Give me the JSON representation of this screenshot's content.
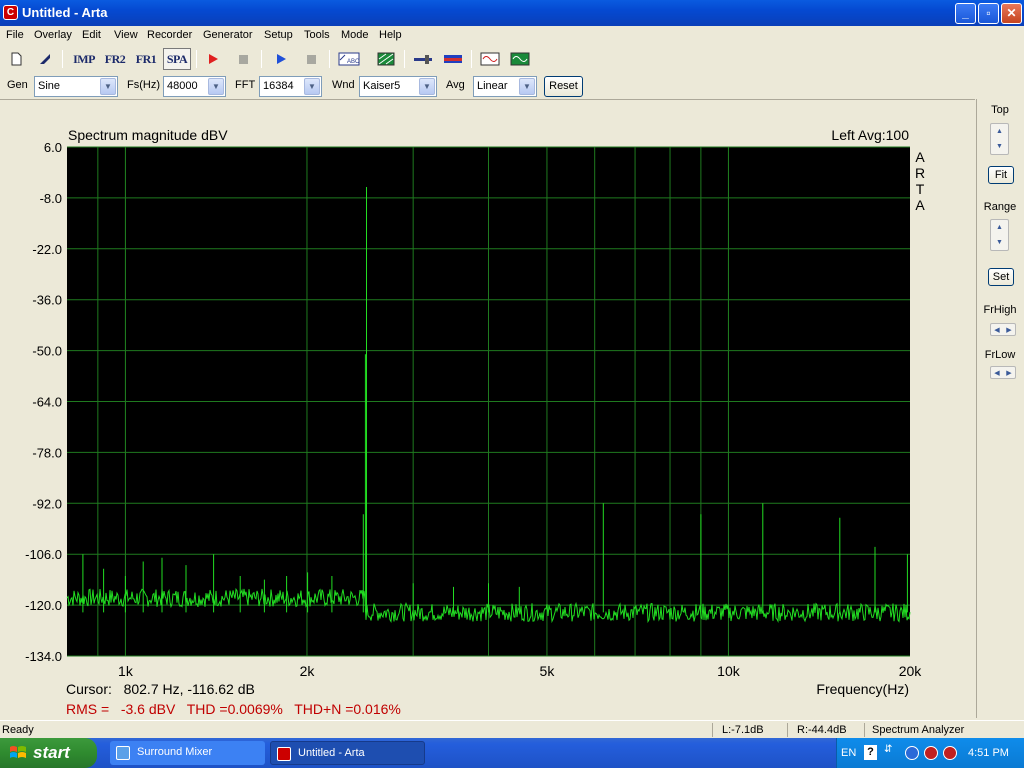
{
  "window": {
    "title": "Untitled - Arta",
    "app_icon": "arta-app-icon",
    "minimize": "_",
    "maximize": "▫",
    "close": "✕"
  },
  "menu": [
    "File",
    "Overlay",
    "Edit",
    "View",
    "Recorder",
    "Generator",
    "Setup",
    "Tools",
    "Mode",
    "Help"
  ],
  "toolbar": {
    "imp": "IMP",
    "fr2": "FR2",
    "fr1": "FR1",
    "spa": "SPA"
  },
  "controls": {
    "gen_label": "Gen",
    "gen_value": "Sine",
    "fs_label": "Fs(Hz)",
    "fs_value": "48000",
    "fft_label": "FFT",
    "fft_value": "16384",
    "wnd_label": "Wnd",
    "wnd_value": "Kaiser5",
    "avg_label": "Avg",
    "avg_value": "Linear",
    "reset": "Reset"
  },
  "right_panel": {
    "top": "Top",
    "fit": "Fit",
    "range": "Range",
    "set": "Set",
    "frhigh": "FrHigh",
    "frlow": "FrLow"
  },
  "chart_data": {
    "type": "line",
    "title": "Spectrum magnitude dBV",
    "info": "Left  Avg:100",
    "watermark": "ARTA",
    "xlabel": "Frequency(Hz)",
    "x_scale": "log",
    "xlim": [
      800,
      20000
    ],
    "x_ticks": [
      {
        "v": 1000,
        "label": "1k"
      },
      {
        "v": 2000,
        "label": "2k"
      },
      {
        "v": 5000,
        "label": "5k"
      },
      {
        "v": 10000,
        "label": "10k"
      },
      {
        "v": 20000,
        "label": "20k"
      }
    ],
    "ylim": [
      -134,
      6
    ],
    "y_ticks": [
      "6.0",
      "-8.0",
      "-22.0",
      "-36.0",
      "-50.0",
      "-64.0",
      "-78.0",
      "-92.0",
      "-106.0",
      "-120.0",
      "-134.0"
    ],
    "grid": true,
    "background": "#000000",
    "line_color": "#22dd22",
    "noise_floor_dbv": -120,
    "peaks": [
      {
        "f": 850,
        "db": -106
      },
      {
        "f": 920,
        "db": -110
      },
      {
        "f": 1000,
        "db": -112
      },
      {
        "f": 1070,
        "db": -108
      },
      {
        "f": 1150,
        "db": -107
      },
      {
        "f": 1260,
        "db": -109
      },
      {
        "f": 1400,
        "db": -106
      },
      {
        "f": 1550,
        "db": -112
      },
      {
        "f": 1700,
        "db": -113
      },
      {
        "f": 1850,
        "db": -112
      },
      {
        "f": 2005,
        "db": -111
      },
      {
        "f": 2200,
        "db": -112
      },
      {
        "f": 2480,
        "db": -95
      },
      {
        "f": 2500,
        "db": -51
      },
      {
        "f": 2510,
        "db": -5
      },
      {
        "f": 3000,
        "db": -114
      },
      {
        "f": 3500,
        "db": -115
      },
      {
        "f": 4000,
        "db": -114
      },
      {
        "f": 4500,
        "db": -115
      },
      {
        "f": 6200,
        "db": -92
      },
      {
        "f": 9000,
        "db": -95
      },
      {
        "f": 11400,
        "db": -92
      },
      {
        "f": 15300,
        "db": -96
      },
      {
        "f": 17500,
        "db": -104
      },
      {
        "f": 19800,
        "db": -106
      }
    ],
    "cursor_text": "Cursor:   802.7 Hz, -116.62 dB",
    "measurements": "RMS =   -3.6 dBV   THD =0.0069%   THD+N =0.016%"
  },
  "status": {
    "ready": "Ready",
    "left": "L:-7.1dB",
    "right": "R:-44.4dB",
    "mode": "Spectrum Analyzer"
  },
  "taskbar": {
    "start": "start",
    "tasks": [
      {
        "label": "Surround Mixer"
      },
      {
        "label": "Untitled - Arta"
      }
    ],
    "lang": "EN",
    "help": "?",
    "clock": "4:51 PM"
  }
}
